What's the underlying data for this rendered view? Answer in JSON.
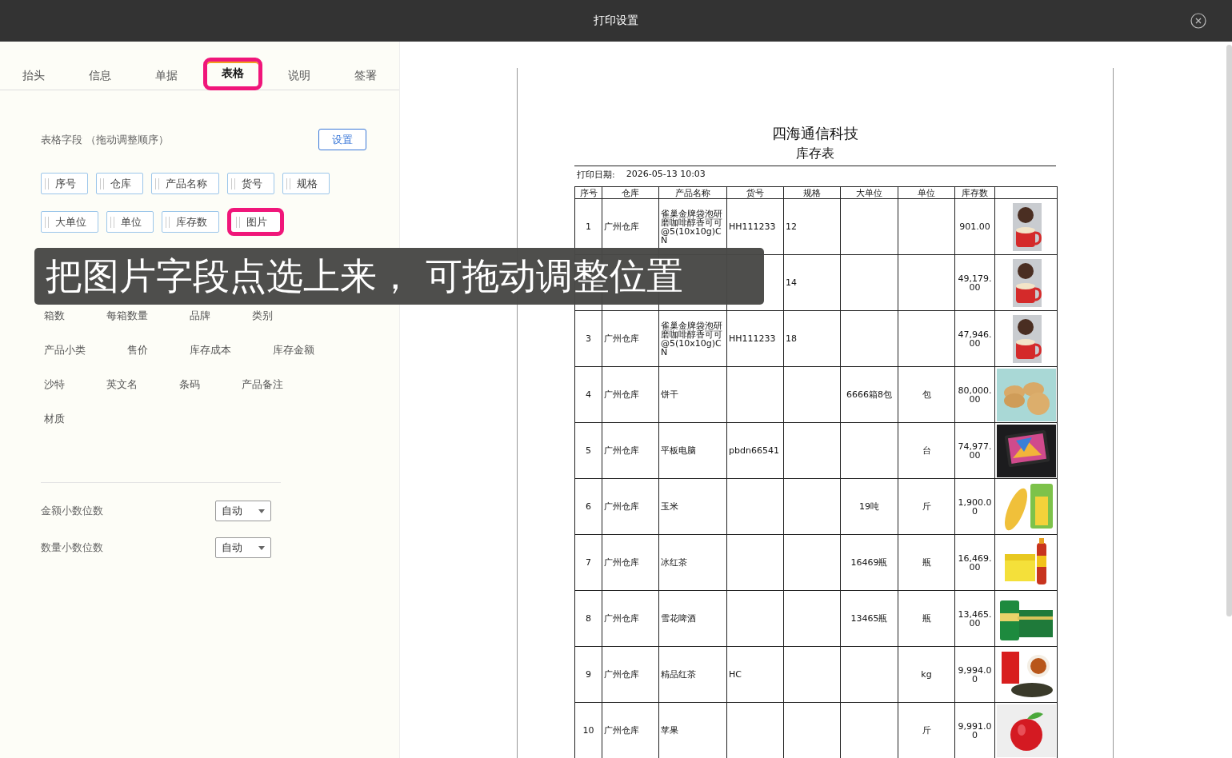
{
  "window": {
    "title": "打印设置"
  },
  "tabs": [
    {
      "label": "抬头",
      "selected": false,
      "highlighted": false
    },
    {
      "label": "信息",
      "selected": false,
      "highlighted": false
    },
    {
      "label": "单据",
      "selected": false,
      "highlighted": false
    },
    {
      "label": "表格",
      "selected": true,
      "highlighted": true
    },
    {
      "label": "说明",
      "selected": false,
      "highlighted": false
    },
    {
      "label": "签署",
      "selected": false,
      "highlighted": false
    }
  ],
  "table_fields": {
    "label": "表格字段 （拖动调整顺序）",
    "button": "设置",
    "chips": [
      {
        "label": "序号",
        "highlighted": false
      },
      {
        "label": "仓库",
        "highlighted": false
      },
      {
        "label": "产品名称",
        "highlighted": false
      },
      {
        "label": "货号",
        "highlighted": false
      },
      {
        "label": "规格",
        "highlighted": false
      },
      {
        "label": "大单位",
        "highlighted": false
      },
      {
        "label": "单位",
        "highlighted": false
      },
      {
        "label": "库存数",
        "highlighted": false
      },
      {
        "label": "图片",
        "highlighted": true
      }
    ]
  },
  "available_fields": [
    [
      "箱数",
      "每箱数量",
      "品牌",
      "类别"
    ],
    [
      "产品小类",
      "售价",
      "库存成本",
      "库存金额"
    ],
    [
      "沙特",
      "英文名",
      "条码",
      "产品备注"
    ],
    [
      "材质"
    ]
  ],
  "decimals": [
    {
      "label": "金额小数位数",
      "value": "自动"
    },
    {
      "label": "数量小数位数",
      "value": "自动"
    }
  ],
  "caption": "把图片字段点选上来， 可拖动调整位置",
  "preview": {
    "company": "四海通信科技",
    "title": "库存表",
    "date_label": "打印日期:",
    "date": "2026-05-13 10:03",
    "columns": [
      "序号",
      "仓库",
      "产品名称",
      "货号",
      "规格",
      "大单位",
      "单位",
      "库存数"
    ],
    "rows": [
      {
        "cells": [
          "1",
          "广州仓库",
          "雀巢金牌袋泡研磨咖啡醇香可可@5(10x10g)CN",
          "HH111233",
          "12",
          null,
          null,
          "901.00"
        ],
        "image": {
          "kind": "picture"
        }
      },
      {
        "cells": [
          null,
          null,
          null,
          null,
          "14",
          null,
          null,
          "49,179.00"
        ],
        "image": {
          "kind": "picture"
        }
      },
      {
        "cells": [
          "3",
          "广州仓库",
          "雀巢金牌袋泡研磨咖啡醇香可可@5(10x10g)CN",
          "HH111233",
          "18",
          null,
          null,
          "47,946.00"
        ],
        "image": {
          "kind": "picture"
        }
      },
      {
        "cells": [
          "4",
          "广州仓库",
          "饼干",
          null,
          null,
          "6666箱8包",
          "包",
          "80,000.00"
        ],
        "image": {
          "kind": "picture"
        }
      },
      {
        "cells": [
          "5",
          "广州仓库",
          "平板电脑",
          "pbdn66541",
          null,
          null,
          "台",
          "74,977.00"
        ],
        "image": {
          "kind": "picture"
        }
      },
      {
        "cells": [
          "6",
          "广州仓库",
          "玉米",
          null,
          null,
          "19吨",
          "斤",
          "1,900.00"
        ],
        "image": {
          "kind": "picture"
        }
      },
      {
        "cells": [
          "7",
          "广州仓库",
          "冰红茶",
          null,
          null,
          "16469瓶",
          "瓶",
          "16,469.00"
        ],
        "image": {
          "kind": "picture"
        }
      },
      {
        "cells": [
          "8",
          "广州仓库",
          "雪花啤酒",
          null,
          null,
          "13465瓶",
          "瓶",
          "13,465.00"
        ],
        "image": {
          "kind": "picture"
        }
      },
      {
        "cells": [
          "9",
          "广州仓库",
          "精品红茶",
          "HC",
          null,
          null,
          "kg",
          "9,994.00"
        ],
        "image": {
          "kind": "picture"
        }
      },
      {
        "cells": [
          "10",
          "广州仓库",
          "苹果",
          null,
          null,
          null,
          "斤",
          "9,991.00"
        ],
        "image": {
          "kind": "picture"
        }
      }
    ]
  }
}
